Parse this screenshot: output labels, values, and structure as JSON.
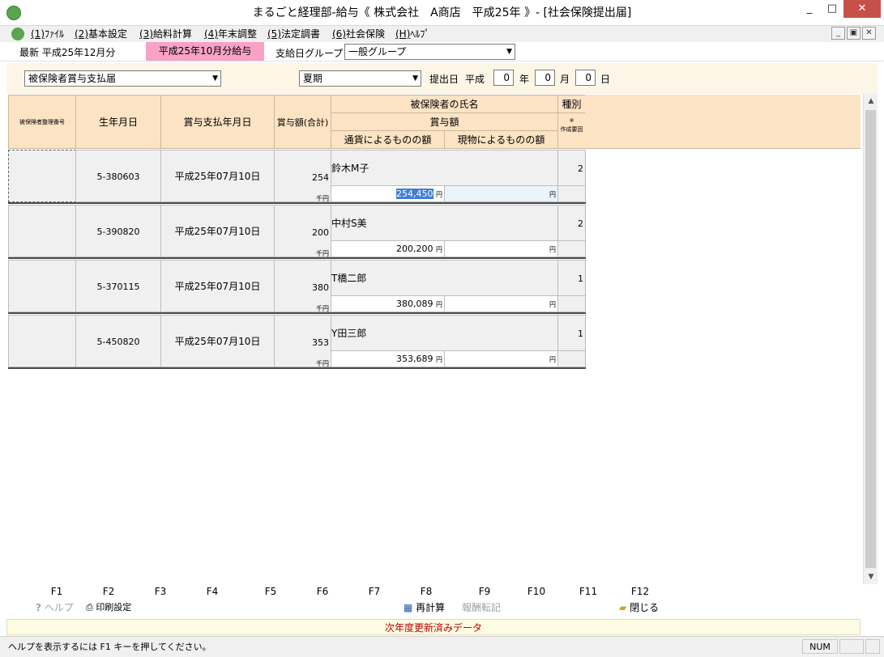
{
  "window": {
    "title": "まるごと経理部-給与《 株式会社　A商店　平成25年 》- [社会保険提出届]",
    "min": "_",
    "max": "□",
    "close": "✕"
  },
  "menu": [
    {
      "key": "(1)",
      "label": "ﾌｧｲﾙ"
    },
    {
      "key": "(2)",
      "label": "基本設定"
    },
    {
      "key": "(3)",
      "label": "給料計算"
    },
    {
      "key": "(4)",
      "label": "年末調整"
    },
    {
      "key": "(5)",
      "label": "法定調書"
    },
    {
      "key": "(6)",
      "label": "社会保険"
    },
    {
      "key": "(H)",
      "label": "ﾍﾙﾌﾟ"
    }
  ],
  "band": {
    "latest": "最新 平成25年12月分",
    "period_badge": "平成25年10月分給与",
    "group_label": "支給日グループ",
    "group_value": "一般グループ"
  },
  "form": {
    "form_type": "被保険者賞与支払届",
    "season": "夏期",
    "submit_label": "提出日",
    "era": "平成",
    "year": "0",
    "year_label": "年",
    "month": "0",
    "month_label": "月",
    "day": "0",
    "day_label": "日"
  },
  "table": {
    "headers": {
      "insured_no": "被保険者整理番号",
      "birth": "生年月日",
      "pay_date": "賞与支払年月日",
      "total": "賞与額(合計)",
      "name": "被保険者の氏名",
      "bonus": "賞与額",
      "currency": "通貨によるものの額",
      "kind": "現物によるものの額",
      "type": "種別",
      "note_mark": "※",
      "note": "作成要因"
    },
    "unit_thousand": "千円",
    "unit_yen": "円",
    "rows": [
      {
        "birth": "5-380603",
        "pay_date": "平成25年07月10日",
        "total": "254",
        "name": "鈴木M子",
        "currency": "254,450",
        "kind": "",
        "type": "2"
      },
      {
        "birth": "5-390820",
        "pay_date": "平成25年07月10日",
        "total": "200",
        "name": "中村S美",
        "currency": "200,200",
        "kind": "",
        "type": "2"
      },
      {
        "birth": "5-370115",
        "pay_date": "平成25年07月10日",
        "total": "380",
        "name": "T橋二郎",
        "currency": "380,089",
        "kind": "",
        "type": "1"
      },
      {
        "birth": "5-450820",
        "pay_date": "平成25年07月10日",
        "total": "353",
        "name": "Y田三郎",
        "currency": "353,689",
        "kind": "",
        "type": "1"
      }
    ]
  },
  "fkeys": [
    "F1",
    "F2",
    "F3",
    "F4",
    "F5",
    "F6",
    "F7",
    "F8",
    "F9",
    "F10",
    "F11",
    "F12"
  ],
  "factions": {
    "help": "ヘルプ",
    "print": "印刷設定",
    "recalc": "再計算",
    "transfer": "報酬転記",
    "close": "閉じる"
  },
  "notice": "次年度更新済みデータ",
  "status": {
    "hint": "ヘルプを表示するには F1 キーを押してください。",
    "num": "NUM"
  }
}
